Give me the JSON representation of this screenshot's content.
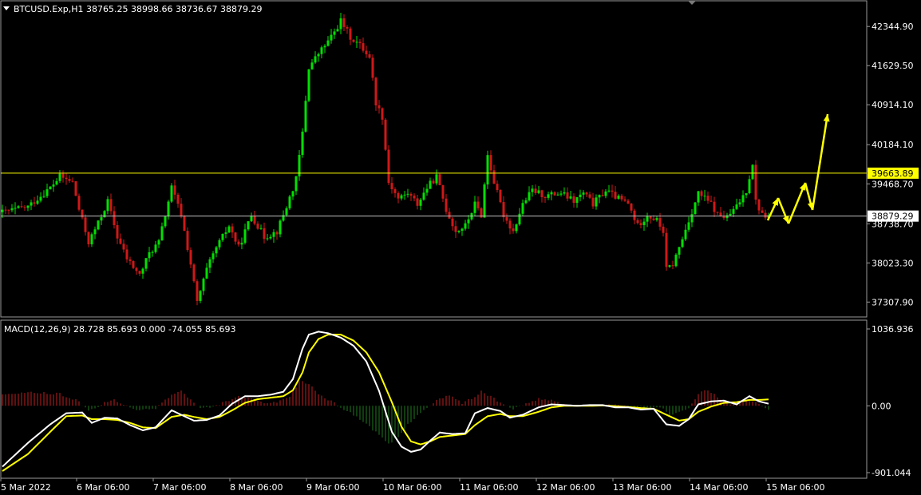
{
  "header": {
    "symbol_line": "BTCUSD.Exp,H1  38765.25 38998.66 38736.67 38879.29",
    "menu_icon": "triangle-down-icon"
  },
  "macd": {
    "label": "MACD(12,26,9) 28.728 85.693 0.000 -74.055 85.693"
  },
  "colors": {
    "background": "#000000",
    "bull": "#00e000",
    "bear": "#d01818",
    "macd_line": "#ffffff",
    "signal_line": "#ffff00",
    "hist_pos": "#c02020",
    "hist_neg": "#1f7a1f",
    "level_line": "#ffff00",
    "price_line": "#c0c0c0",
    "arrows": "#ffff00"
  },
  "chart_data": [
    {
      "type": "candlestick",
      "ylim": [
        37050,
        42800
      ],
      "yticks": [
        {
          "value": 42344.9,
          "label": "42344.90"
        },
        {
          "value": 41629.5,
          "label": "41629.50"
        },
        {
          "value": 40914.1,
          "label": "40914.10"
        },
        {
          "value": 40184.1,
          "label": "40184.10"
        },
        {
          "value": 39468.7,
          "label": "39468.70"
        },
        {
          "value": 38738.7,
          "label": "38738.70"
        },
        {
          "value": 38023.3,
          "label": "38023.30"
        },
        {
          "value": 37307.9,
          "label": "37307.90"
        }
      ],
      "xticks": [
        "5 Mar 2022",
        "6 Mar 06:00",
        "7 Mar 06:00",
        "8 Mar 06:00",
        "9 Mar 06:00",
        "10 Mar 06:00",
        "11 Mar 06:00",
        "12 Mar 06:00",
        "13 Mar 06:00",
        "14 Mar 06:00",
        "15 Mar 06:00"
      ],
      "horizontal_level": {
        "value": 39663.89,
        "label": "39663.89"
      },
      "current_price": {
        "value": 38879.29,
        "label": "38879.29"
      },
      "close_path": [
        [
          0,
          38950
        ],
        [
          8,
          39050
        ],
        [
          15,
          39400
        ],
        [
          18,
          39600
        ],
        [
          22,
          39500
        ],
        [
          24,
          39000
        ],
        [
          27,
          38400
        ],
        [
          30,
          38750
        ],
        [
          33,
          39150
        ],
        [
          36,
          38500
        ],
        [
          39,
          38100
        ],
        [
          43,
          37800
        ],
        [
          46,
          38200
        ],
        [
          49,
          38400
        ],
        [
          53,
          39400
        ],
        [
          56,
          38900
        ],
        [
          59,
          38000
        ],
        [
          61,
          37300
        ],
        [
          64,
          37900
        ],
        [
          67,
          38300
        ],
        [
          71,
          38700
        ],
        [
          74,
          38300
        ],
        [
          78,
          38900
        ],
        [
          82,
          38500
        ],
        [
          86,
          38600
        ],
        [
          89,
          39050
        ],
        [
          92,
          39550
        ],
        [
          94,
          40400
        ],
        [
          96,
          41600
        ],
        [
          99,
          41850
        ],
        [
          103,
          42150
        ],
        [
          106,
          42450
        ],
        [
          109,
          42150
        ],
        [
          112,
          42000
        ],
        [
          115,
          41800
        ],
        [
          117,
          40950
        ],
        [
          119,
          40700
        ],
        [
          121,
          39500
        ],
        [
          124,
          39200
        ],
        [
          127,
          39300
        ],
        [
          130,
          39100
        ],
        [
          133,
          39400
        ],
        [
          136,
          39600
        ],
        [
          139,
          39000
        ],
        [
          142,
          38600
        ],
        [
          145,
          38700
        ],
        [
          148,
          39100
        ],
        [
          150,
          38900
        ],
        [
          152,
          40000
        ],
        [
          154,
          39500
        ],
        [
          157,
          38900
        ],
        [
          160,
          38600
        ],
        [
          163,
          39100
        ],
        [
          166,
          39350
        ],
        [
          170,
          39250
        ],
        [
          175,
          39300
        ],
        [
          179,
          39150
        ],
        [
          182,
          39300
        ],
        [
          185,
          39100
        ],
        [
          189,
          39350
        ],
        [
          193,
          39200
        ],
        [
          196,
          39100
        ],
        [
          199,
          38700
        ],
        [
          202,
          38900
        ],
        [
          205,
          38800
        ],
        [
          207,
          38600
        ],
        [
          208,
          37900
        ],
        [
          210,
          38000
        ],
        [
          212,
          38300
        ],
        [
          215,
          38800
        ],
        [
          218,
          39300
        ],
        [
          222,
          39100
        ],
        [
          224,
          38900
        ],
        [
          227,
          38850
        ],
        [
          230,
          39050
        ],
        [
          233,
          39350
        ],
        [
          235,
          39850
        ],
        [
          236,
          39150
        ],
        [
          238,
          38900
        ],
        [
          240,
          38879
        ]
      ],
      "forecast_arrows": [
        [
          [
            962,
            276
          ],
          [
            975,
            248
          ]
        ],
        [
          [
            975,
            248
          ],
          [
            988,
            280
          ]
        ],
        [
          [
            988,
            280
          ],
          [
            1009,
            229
          ]
        ],
        [
          [
            1009,
            229
          ],
          [
            1018,
            263
          ]
        ],
        [
          [
            1018,
            263
          ],
          [
            1037,
            143
          ]
        ]
      ]
    },
    {
      "type": "macd",
      "ylim": [
        -901.044,
        1036.936
      ],
      "yticks": [
        {
          "value": 1036.936,
          "label": "1036.936"
        },
        {
          "value": 0.0,
          "label": "0.00"
        },
        {
          "value": -901.044,
          "label": "-901.044"
        }
      ],
      "macd_line": [
        [
          0,
          -820
        ],
        [
          8,
          -500
        ],
        [
          15,
          -250
        ],
        [
          20,
          -100
        ],
        [
          25,
          -90
        ],
        [
          28,
          -230
        ],
        [
          32,
          -160
        ],
        [
          36,
          -170
        ],
        [
          40,
          -260
        ],
        [
          44,
          -330
        ],
        [
          48,
          -290
        ],
        [
          53,
          -60
        ],
        [
          57,
          -140
        ],
        [
          60,
          -200
        ],
        [
          64,
          -190
        ],
        [
          68,
          -130
        ],
        [
          72,
          30
        ],
        [
          76,
          130
        ],
        [
          80,
          130
        ],
        [
          84,
          150
        ],
        [
          88,
          190
        ],
        [
          91,
          360
        ],
        [
          94,
          770
        ],
        [
          96,
          960
        ],
        [
          99,
          1000
        ],
        [
          102,
          980
        ],
        [
          106,
          920
        ],
        [
          110,
          810
        ],
        [
          114,
          600
        ],
        [
          118,
          200
        ],
        [
          122,
          -350
        ],
        [
          125,
          -550
        ],
        [
          128,
          -620
        ],
        [
          131,
          -590
        ],
        [
          134,
          -470
        ],
        [
          137,
          -360
        ],
        [
          141,
          -380
        ],
        [
          145,
          -370
        ],
        [
          148,
          -100
        ],
        [
          152,
          -30
        ],
        [
          156,
          -70
        ],
        [
          159,
          -160
        ],
        [
          163,
          -120
        ],
        [
          168,
          -20
        ],
        [
          172,
          20
        ],
        [
          176,
          10
        ],
        [
          180,
          0
        ],
        [
          184,
          10
        ],
        [
          188,
          10
        ],
        [
          192,
          -20
        ],
        [
          196,
          -20
        ],
        [
          200,
          -50
        ],
        [
          204,
          -40
        ],
        [
          208,
          -250
        ],
        [
          212,
          -270
        ],
        [
          215,
          -180
        ],
        [
          218,
          20
        ],
        [
          222,
          60
        ],
        [
          226,
          70
        ],
        [
          230,
          20
        ],
        [
          234,
          130
        ],
        [
          237,
          60
        ],
        [
          240,
          29
        ]
      ],
      "signal_line": [
        [
          0,
          -880
        ],
        [
          8,
          -650
        ],
        [
          15,
          -350
        ],
        [
          20,
          -140
        ],
        [
          25,
          -130
        ],
        [
          28,
          -180
        ],
        [
          32,
          -180
        ],
        [
          36,
          -190
        ],
        [
          40,
          -230
        ],
        [
          44,
          -290
        ],
        [
          48,
          -300
        ],
        [
          53,
          -150
        ],
        [
          57,
          -120
        ],
        [
          60,
          -150
        ],
        [
          64,
          -180
        ],
        [
          68,
          -150
        ],
        [
          72,
          -60
        ],
        [
          76,
          40
        ],
        [
          80,
          90
        ],
        [
          84,
          110
        ],
        [
          88,
          130
        ],
        [
          91,
          210
        ],
        [
          94,
          450
        ],
        [
          96,
          720
        ],
        [
          99,
          900
        ],
        [
          102,
          960
        ],
        [
          106,
          960
        ],
        [
          110,
          880
        ],
        [
          114,
          720
        ],
        [
          118,
          450
        ],
        [
          122,
          50
        ],
        [
          125,
          -280
        ],
        [
          128,
          -480
        ],
        [
          131,
          -520
        ],
        [
          134,
          -480
        ],
        [
          137,
          -420
        ],
        [
          141,
          -400
        ],
        [
          145,
          -380
        ],
        [
          148,
          -260
        ],
        [
          152,
          -140
        ],
        [
          156,
          -110
        ],
        [
          159,
          -140
        ],
        [
          163,
          -140
        ],
        [
          168,
          -80
        ],
        [
          172,
          -20
        ],
        [
          176,
          0
        ],
        [
          180,
          0
        ],
        [
          184,
          0
        ],
        [
          188,
          5
        ],
        [
          192,
          -5
        ],
        [
          196,
          -15
        ],
        [
          200,
          -30
        ],
        [
          204,
          -40
        ],
        [
          208,
          -120
        ],
        [
          212,
          -200
        ],
        [
          215,
          -180
        ],
        [
          218,
          -80
        ],
        [
          222,
          -10
        ],
        [
          226,
          40
        ],
        [
          230,
          50
        ],
        [
          234,
          80
        ],
        [
          237,
          80
        ],
        [
          240,
          86
        ]
      ],
      "histogram": [
        [
          0,
          150
        ],
        [
          10,
          180
        ],
        [
          18,
          160
        ],
        [
          24,
          60
        ],
        [
          27,
          -80
        ],
        [
          32,
          40
        ],
        [
          35,
          80
        ],
        [
          40,
          -30
        ],
        [
          44,
          -60
        ],
        [
          48,
          -30
        ],
        [
          53,
          150
        ],
        [
          56,
          200
        ],
        [
          59,
          80
        ],
        [
          62,
          -40
        ],
        [
          66,
          -20
        ],
        [
          70,
          60
        ],
        [
          74,
          120
        ],
        [
          78,
          90
        ],
        [
          82,
          40
        ],
        [
          86,
          40
        ],
        [
          90,
          120
        ],
        [
          93,
          330
        ],
        [
          96,
          300
        ],
        [
          99,
          160
        ],
        [
          103,
          60
        ],
        [
          106,
          -20
        ],
        [
          110,
          -120
        ],
        [
          114,
          -240
        ],
        [
          118,
          -400
        ],
        [
          121,
          -520
        ],
        [
          124,
          -420
        ],
        [
          127,
          -250
        ],
        [
          130,
          -120
        ],
        [
          134,
          0
        ],
        [
          137,
          100
        ],
        [
          140,
          140
        ],
        [
          144,
          40
        ],
        [
          148,
          120
        ],
        [
          150,
          200
        ],
        [
          153,
          120
        ],
        [
          157,
          20
        ],
        [
          160,
          -50
        ],
        [
          164,
          30
        ],
        [
          168,
          100
        ],
        [
          172,
          70
        ],
        [
          176,
          20
        ],
        [
          180,
          10
        ],
        [
          185,
          10
        ],
        [
          190,
          10
        ],
        [
          194,
          0
        ],
        [
          198,
          -20
        ],
        [
          202,
          -30
        ],
        [
          206,
          -10
        ],
        [
          209,
          -120
        ],
        [
          212,
          -80
        ],
        [
          215,
          -20
        ],
        [
          218,
          160
        ],
        [
          221,
          220
        ],
        [
          224,
          120
        ],
        [
          228,
          30
        ],
        [
          231,
          30
        ],
        [
          234,
          80
        ],
        [
          237,
          20
        ],
        [
          240,
          -60
        ]
      ]
    }
  ]
}
